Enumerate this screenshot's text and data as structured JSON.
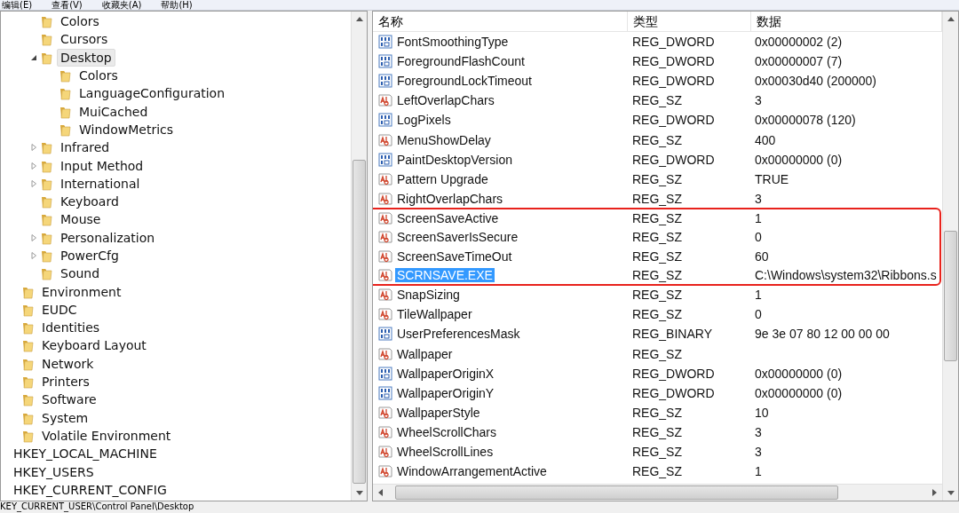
{
  "menu_bar": [
    "编辑(E)",
    "查看(V)",
    "收藏夹(A)",
    "帮助(H)"
  ],
  "tree": [
    {
      "children": [
        {
          "children": [
            {
              "kind": "folder",
              "label": "Colors",
              "has_children": false,
              "selected": false
            },
            {
              "kind": "folder",
              "label": "Cursors",
              "has_children": false,
              "selected": false
            },
            {
              "kind": "folder",
              "label": "Desktop",
              "has_children": true,
              "expanded": true,
              "selected": true,
              "children": [
                {
                  "kind": "folder",
                  "label": "Colors",
                  "has_children": false,
                  "selected": false
                },
                {
                  "kind": "folder",
                  "label": "LanguageConfiguration",
                  "has_children": false,
                  "selected": false
                },
                {
                  "kind": "folder",
                  "label": "MuiCached",
                  "has_children": false,
                  "selected": false
                },
                {
                  "kind": "folder",
                  "label": "WindowMetrics",
                  "has_children": false,
                  "selected": false
                }
              ]
            },
            {
              "kind": "folder",
              "label": "Infrared",
              "has_children": true,
              "expanded": false,
              "selected": false
            },
            {
              "kind": "folder",
              "label": "Input Method",
              "has_children": true,
              "expanded": false,
              "selected": false
            },
            {
              "kind": "folder",
              "label": "International",
              "has_children": true,
              "expanded": false,
              "selected": false
            },
            {
              "kind": "folder",
              "label": "Keyboard",
              "has_children": false,
              "selected": false
            },
            {
              "kind": "folder",
              "label": "Mouse",
              "has_children": false,
              "selected": false
            },
            {
              "kind": "folder",
              "label": "Personalization",
              "has_children": true,
              "expanded": false,
              "selected": false
            },
            {
              "kind": "folder",
              "label": "PowerCfg",
              "has_children": true,
              "expanded": false,
              "selected": false
            },
            {
              "kind": "folder",
              "label": "Sound",
              "has_children": false,
              "selected": false
            }
          ]
        },
        {
          "kind": "folder",
          "label": "Environment",
          "has_children": false,
          "selected": false
        },
        {
          "kind": "folder",
          "label": "EUDC",
          "has_children": false,
          "selected": false
        },
        {
          "kind": "folder",
          "label": "Identities",
          "has_children": false,
          "selected": false
        },
        {
          "kind": "folder",
          "label": "Keyboard Layout",
          "has_children": false,
          "selected": false
        },
        {
          "kind": "folder",
          "label": "Network",
          "has_children": false,
          "selected": false
        },
        {
          "kind": "folder",
          "label": "Printers",
          "has_children": false,
          "selected": false
        },
        {
          "kind": "folder",
          "label": "Software",
          "has_children": false,
          "selected": false
        },
        {
          "kind": "folder",
          "label": "System",
          "has_children": false,
          "selected": false
        },
        {
          "kind": "folder",
          "label": "Volatile Environment",
          "has_children": false,
          "selected": false
        }
      ]
    },
    {
      "kind": "hive",
      "label": "HKEY_LOCAL_MACHINE",
      "has_children": false,
      "selected": false
    },
    {
      "kind": "hive",
      "label": "HKEY_USERS",
      "has_children": false,
      "selected": false
    },
    {
      "kind": "hive",
      "label": "HKEY_CURRENT_CONFIG",
      "has_children": false,
      "selected": false
    }
  ],
  "table": {
    "columns": [
      "名称",
      "类型",
      "数据"
    ],
    "rows": [
      {
        "kind": "binary",
        "name": "FontSmoothingType",
        "type": "REG_DWORD",
        "data": "0x00000002 (2)",
        "selected": false,
        "marked": false
      },
      {
        "kind": "binary",
        "name": "ForegroundFlashCount",
        "type": "REG_DWORD",
        "data": "0x00000007 (7)",
        "selected": false,
        "marked": false
      },
      {
        "kind": "binary",
        "name": "ForegroundLockTimeout",
        "type": "REG_DWORD",
        "data": "0x00030d40 (200000)",
        "selected": false,
        "marked": false
      },
      {
        "kind": "string",
        "name": "LeftOverlapChars",
        "type": "REG_SZ",
        "data": "3",
        "selected": false,
        "marked": false
      },
      {
        "kind": "binary",
        "name": "LogPixels",
        "type": "REG_DWORD",
        "data": "0x00000078 (120)",
        "selected": false,
        "marked": false
      },
      {
        "kind": "string",
        "name": "MenuShowDelay",
        "type": "REG_SZ",
        "data": "400",
        "selected": false,
        "marked": false
      },
      {
        "kind": "binary",
        "name": "PaintDesktopVersion",
        "type": "REG_DWORD",
        "data": "0x00000000 (0)",
        "selected": false,
        "marked": false
      },
      {
        "kind": "string",
        "name": "Pattern Upgrade",
        "type": "REG_SZ",
        "data": "TRUE",
        "selected": false,
        "marked": false
      },
      {
        "kind": "string",
        "name": "RightOverlapChars",
        "type": "REG_SZ",
        "data": "3",
        "selected": false,
        "marked": false
      },
      {
        "kind": "string",
        "name": "ScreenSaveActive",
        "type": "REG_SZ",
        "data": "1",
        "selected": false,
        "marked": true
      },
      {
        "kind": "string",
        "name": "ScreenSaverIsSecure",
        "type": "REG_SZ",
        "data": "0",
        "selected": false,
        "marked": true
      },
      {
        "kind": "string",
        "name": "ScreenSaveTimeOut",
        "type": "REG_SZ",
        "data": "60",
        "selected": false,
        "marked": true
      },
      {
        "kind": "string",
        "name": "SCRNSAVE.EXE",
        "type": "REG_SZ",
        "data": "C:\\Windows\\system32\\Ribbons.s",
        "selected": true,
        "marked": true
      },
      {
        "kind": "string",
        "name": "SnapSizing",
        "type": "REG_SZ",
        "data": "1",
        "selected": false,
        "marked": false
      },
      {
        "kind": "string",
        "name": "TileWallpaper",
        "type": "REG_SZ",
        "data": "0",
        "selected": false,
        "marked": false
      },
      {
        "kind": "binary",
        "name": "UserPreferencesMask",
        "type": "REG_BINARY",
        "data": "9e 3e 07 80 12 00 00 00",
        "selected": false,
        "marked": false
      },
      {
        "kind": "string",
        "name": "Wallpaper",
        "type": "REG_SZ",
        "selected": false,
        "marked": false
      },
      {
        "kind": "binary",
        "name": "WallpaperOriginX",
        "type": "REG_DWORD",
        "data": "0x00000000 (0)",
        "selected": false,
        "marked": false
      },
      {
        "kind": "binary",
        "name": "WallpaperOriginY",
        "type": "REG_DWORD",
        "data": "0x00000000 (0)",
        "selected": false,
        "marked": false
      },
      {
        "kind": "string",
        "name": "WallpaperStyle",
        "type": "REG_SZ",
        "data": "10",
        "selected": false,
        "marked": false
      },
      {
        "kind": "string",
        "name": "WheelScrollChars",
        "type": "REG_SZ",
        "data": "3",
        "selected": false,
        "marked": false
      },
      {
        "kind": "string",
        "name": "WheelScrollLines",
        "type": "REG_SZ",
        "data": "3",
        "selected": false,
        "marked": false
      },
      {
        "kind": "string",
        "name": "WindowArrangementActive",
        "type": "REG_SZ",
        "data": "1",
        "selected": false,
        "marked": false
      }
    ]
  },
  "status_bar": "KEY_CURRENT_USER\\Control Panel\\Desktop"
}
